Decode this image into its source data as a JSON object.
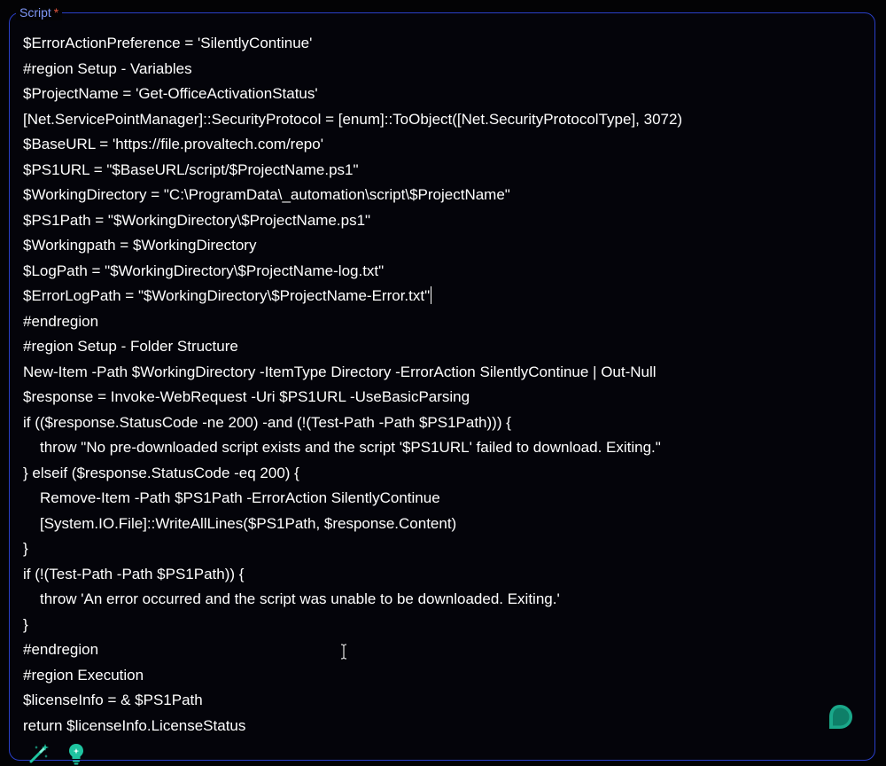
{
  "field": {
    "label": "Script",
    "required_marker": "*"
  },
  "code": {
    "lines": [
      {
        "text": "$ErrorActionPreference = 'SilentlyContinue'",
        "indent": false
      },
      {
        "text": "#region Setup - Variables",
        "indent": false
      },
      {
        "text": "$ProjectName = 'Get-OfficeActivationStatus'",
        "indent": false
      },
      {
        "text": "[Net.ServicePointManager]::SecurityProtocol = [enum]::ToObject([Net.SecurityProtocolType], 3072)",
        "indent": false
      },
      {
        "text": "$BaseURL = 'https://file.provaltech.com/repo'",
        "indent": false
      },
      {
        "text": "$PS1URL = \"$BaseURL/script/$ProjectName.ps1\"",
        "indent": false
      },
      {
        "text": "$WorkingDirectory = \"C:\\ProgramData\\_automation\\script\\$ProjectName\"",
        "indent": false
      },
      {
        "text": "$PS1Path = \"$WorkingDirectory\\$ProjectName.ps1\"",
        "indent": false
      },
      {
        "text": "$Workingpath = $WorkingDirectory",
        "indent": false
      },
      {
        "text": "$LogPath = \"$WorkingDirectory\\$ProjectName-log.txt\"",
        "indent": false
      },
      {
        "text": "$ErrorLogPath = \"$WorkingDirectory\\$ProjectName-Error.txt\"",
        "indent": false
      },
      {
        "text": "#endregion",
        "indent": false
      },
      {
        "text": "#region Setup - Folder Structure",
        "indent": false
      },
      {
        "text": "New-Item -Path $WorkingDirectory -ItemType Directory -ErrorAction SilentlyContinue | Out-Null",
        "indent": false
      },
      {
        "text": "$response = Invoke-WebRequest -Uri $PS1URL -UseBasicParsing",
        "indent": false
      },
      {
        "text": "if (($response.StatusCode -ne 200) -and (!(Test-Path -Path $PS1Path))) {",
        "indent": false
      },
      {
        "text": "throw \"No pre-downloaded script exists and the script '$PS1URL' failed to download. Exiting.\"",
        "indent": true
      },
      {
        "text": "} elseif ($response.StatusCode -eq 200) {",
        "indent": false
      },
      {
        "text": "Remove-Item -Path $PS1Path -ErrorAction SilentlyContinue",
        "indent": true
      },
      {
        "text": "[System.IO.File]::WriteAllLines($PS1Path, $response.Content)",
        "indent": true
      },
      {
        "text": "}",
        "indent": false
      },
      {
        "text": "if (!(Test-Path -Path $PS1Path)) {",
        "indent": false
      },
      {
        "text": "throw 'An error occurred and the script was unable to be downloaded. Exiting.'",
        "indent": true
      },
      {
        "text": "}",
        "indent": false
      },
      {
        "text": "#endregion",
        "indent": false
      },
      {
        "text": "#region Execution",
        "indent": false
      },
      {
        "text": "$licenseInfo = & $PS1Path",
        "indent": false
      },
      {
        "text": "return $licenseInfo.LicenseStatus",
        "indent": false
      }
    ],
    "caret_line": 10
  },
  "icons": {
    "chat": "chat-bubble-icon",
    "magic": "magic-wand-icon",
    "bulb": "lightbulb-icon",
    "cursor": "text-cursor-icon"
  },
  "colors": {
    "border": "#2a3fc8",
    "label": "#7f97f5",
    "required": "#e0553e",
    "accent": "#1aa88a",
    "text": "#ffffff",
    "background": "#030305"
  }
}
